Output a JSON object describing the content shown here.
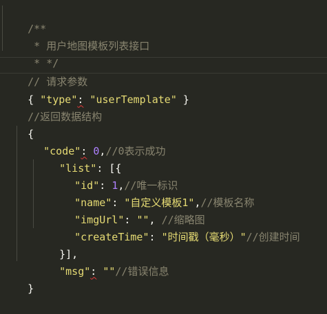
{
  "colors": {
    "background": "#272822",
    "comment": "#88846f",
    "string": "#e6db74",
    "number": "#ae81ff",
    "plain": "#f8f8f2",
    "indent_guide": "#4a4b43",
    "squiggle": "#e83a3a"
  },
  "lines": {
    "l1": "/**",
    "l2": " * 用户地图模板列表接口",
    "l3": " * */",
    "l4": "// 请求参数",
    "l5_open": "{ ",
    "l5_key": "\"type\"",
    "l5_colon": ":",
    "l5_val": " \"userTemplate\"",
    "l5_close": " }",
    "l6": "//返回数据结构",
    "l7": "{",
    "l8_key": "\"code\"",
    "l8_colon": ":",
    "l8_num": " 0",
    "l8_comma": ",",
    "l8_comment": "//0表示成功",
    "l9_key": "\"list\"",
    "l9_rest": ": [{",
    "l10_key": "\"id\"",
    "l10_colon": ": ",
    "l10_num": "1",
    "l10_comma": ",",
    "l10_comment": "//唯一标识",
    "l11_key": "\"name\"",
    "l11_colon": ": ",
    "l11_val": "\"自定义模板1\"",
    "l11_comma": ",",
    "l11_comment": "//模板名称",
    "l12_key": "\"imgUrl\"",
    "l12_colon": ": ",
    "l12_val": "\"\"",
    "l12_comma": ", ",
    "l12_comment": "//缩略图",
    "l13_key": "\"createTime\"",
    "l13_colon": ": ",
    "l13_val": "\"时间戳（毫秒）\"",
    "l13_comment": "//创建时间",
    "l14": "}],",
    "l15_key": "\"msg\"",
    "l15_colon": ":",
    "l15_val": " \"\"",
    "l15_comment": "//错误信息",
    "l16": "}"
  }
}
